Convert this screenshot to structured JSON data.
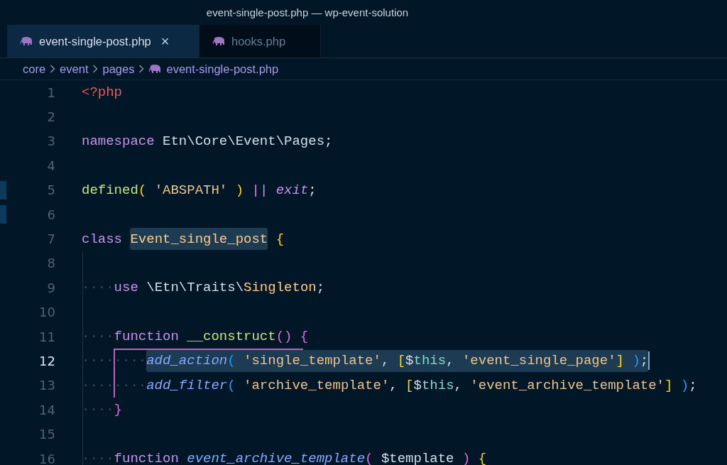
{
  "window": {
    "title": "event-single-post.php — wp-event-solution"
  },
  "tabs": [
    {
      "label": "event-single-post.php",
      "selected": true,
      "close": "×"
    },
    {
      "label": "hooks.php",
      "selected": false
    }
  ],
  "breadcrumb": [
    "core",
    "event",
    "pages",
    "event-single-post.php"
  ],
  "lines": [
    {
      "number": "1",
      "current": false,
      "edge_mark": false,
      "segments": [
        {
          "marked": false,
          "tokens": [
            {
              "kind": "tag",
              "text": "<?php"
            }
          ]
        }
      ]
    },
    {
      "number": "2",
      "current": false,
      "edge_mark": false
    },
    {
      "number": "3",
      "current": false,
      "edge_mark": false,
      "segments": [
        {
          "marked": false,
          "tokens": [
            {
              "kind": "kw",
              "text": "namespace"
            },
            {
              "kind": "plain",
              "text": " Etn\\Core\\Event\\Pages;"
            }
          ]
        }
      ]
    },
    {
      "number": "4",
      "current": false,
      "edge_mark": false
    },
    {
      "number": "5",
      "current": false,
      "edge_mark": true,
      "segments": [
        {
          "marked": false,
          "tokens": [
            {
              "kind": "fn",
              "text": "defined"
            },
            {
              "kind": "b1",
              "text": "("
            },
            {
              "kind": "str",
              "text": " 'ABSPATH'"
            },
            {
              "kind": "b1",
              "text": " )"
            },
            {
              "kind": "kw",
              "text": " ||"
            },
            {
              "kind": "kwi",
              "text": " exit"
            },
            {
              "kind": "plain",
              "text": ";"
            }
          ]
        }
      ]
    },
    {
      "number": "6",
      "current": false,
      "edge_mark": true
    },
    {
      "number": "7",
      "current": false,
      "edge_mark": false,
      "segments": [
        {
          "marked": false,
          "tokens": [
            {
              "kind": "kw",
              "text": "class "
            }
          ]
        },
        {
          "marked": true,
          "tokens": [
            {
              "kind": "cls",
              "text": "Event_single_post"
            }
          ]
        },
        {
          "marked": false,
          "tokens": [
            {
              "kind": "b1",
              "text": " {"
            }
          ]
        }
      ]
    },
    {
      "number": "8",
      "current": false,
      "edge_mark": false
    },
    {
      "number": "9",
      "current": false,
      "edge_mark": false,
      "segments": [
        {
          "marked": false,
          "tokens": [
            {
              "kind": "ws",
              "text": "····"
            },
            {
              "kind": "kw",
              "text": "use"
            },
            {
              "kind": "plain",
              "text": " \\Etn\\Traits\\"
            },
            {
              "kind": "cls",
              "text": "Singleton"
            },
            {
              "kind": "plain",
              "text": ";"
            }
          ]
        }
      ]
    },
    {
      "number": "10",
      "current": false,
      "edge_mark": false
    },
    {
      "number": "11",
      "current": false,
      "edge_mark": false,
      "segments": [
        {
          "marked": false,
          "tokens": [
            {
              "kind": "ws",
              "text": "····"
            },
            {
              "kind": "kw",
              "text": "function"
            },
            {
              "kind": "fn",
              "text": " __construct"
            },
            {
              "kind": "b2",
              "text": "()"
            },
            {
              "kind": "b2",
              "text": " {"
            }
          ]
        }
      ]
    },
    {
      "number": "12",
      "current": true,
      "edge_mark": false,
      "segments": [
        {
          "marked": false,
          "tokens": [
            {
              "kind": "ws",
              "text": "····"
            },
            {
              "kind": "ws",
              "text": "····"
            }
          ]
        },
        {
          "marked": true,
          "tokens": [
            {
              "kind": "call",
              "text": "add_action"
            },
            {
              "kind": "b3",
              "text": "("
            },
            {
              "kind": "str",
              "text": " 'single_template'"
            },
            {
              "kind": "plain",
              "text": ","
            },
            {
              "kind": "b1",
              "text": " ["
            },
            {
              "kind": "plain",
              "text": "$"
            },
            {
              "kind": "var",
              "text": "this"
            },
            {
              "kind": "plain",
              "text": ","
            },
            {
              "kind": "str",
              "text": " 'event_single_page'"
            },
            {
              "kind": "b1",
              "text": "]"
            },
            {
              "kind": "b3",
              "text": " )"
            },
            {
              "kind": "plain",
              "text": ";"
            }
          ]
        }
      ]
    },
    {
      "number": "13",
      "current": false,
      "edge_mark": false,
      "segments": [
        {
          "marked": false,
          "tokens": [
            {
              "kind": "ws",
              "text": "····"
            },
            {
              "kind": "ws",
              "text": "····"
            },
            {
              "kind": "call",
              "text": "add_filter"
            },
            {
              "kind": "b3",
              "text": "("
            },
            {
              "kind": "str",
              "text": " 'archive_template'"
            },
            {
              "kind": "plain",
              "text": ","
            },
            {
              "kind": "b1",
              "text": " ["
            },
            {
              "kind": "plain",
              "text": "$"
            },
            {
              "kind": "var",
              "text": "this"
            },
            {
              "kind": "plain",
              "text": ","
            },
            {
              "kind": "str",
              "text": " 'event_archive_template'"
            },
            {
              "kind": "b1",
              "text": "]"
            },
            {
              "kind": "b3",
              "text": " )"
            },
            {
              "kind": "plain",
              "text": ";"
            }
          ]
        }
      ]
    },
    {
      "number": "14",
      "current": false,
      "edge_mark": false,
      "segments": [
        {
          "marked": false,
          "tokens": [
            {
              "kind": "ws",
              "text": "····"
            },
            {
              "kind": "b2",
              "text": "}"
            }
          ]
        }
      ]
    },
    {
      "number": "15",
      "current": false,
      "edge_mark": false
    },
    {
      "number": "16",
      "current": false,
      "edge_mark": false,
      "segments": [
        {
          "marked": false,
          "tokens": [
            {
              "kind": "ws",
              "text": "····"
            },
            {
              "kind": "kw",
              "text": "function"
            },
            {
              "kind": "call",
              "text": " event_archive_template"
            },
            {
              "kind": "b2",
              "text": "("
            },
            {
              "kind": "plain",
              "text": " $template"
            },
            {
              "kind": "b2",
              "text": " )"
            },
            {
              "kind": "b1",
              "text": " {"
            }
          ]
        }
      ]
    }
  ]
}
